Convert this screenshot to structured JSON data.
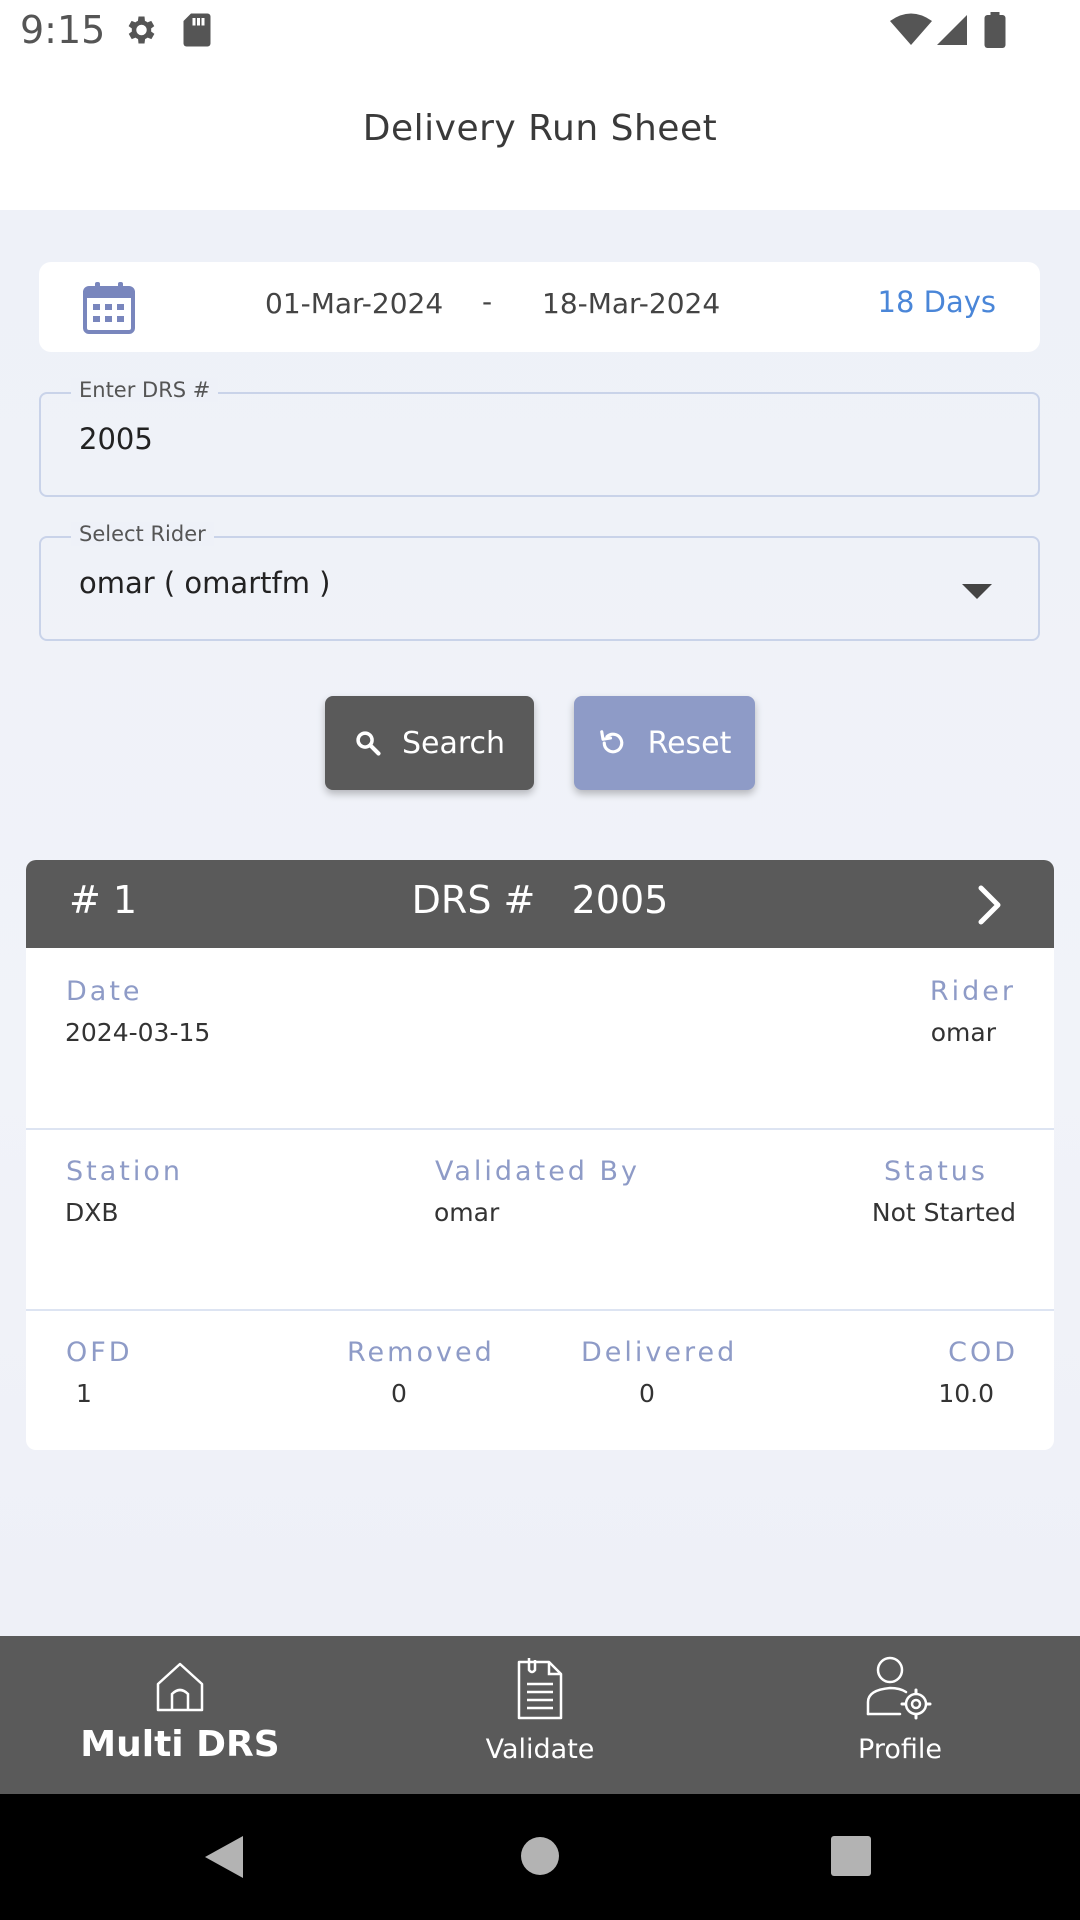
{
  "status_bar": {
    "time": "9:15"
  },
  "header": {
    "title": "Delivery Run Sheet"
  },
  "date_range": {
    "from": "01-Mar-2024",
    "separator": "-",
    "to": "18-Mar-2024",
    "days": "18 Days"
  },
  "drs_field": {
    "label": "Enter DRS #",
    "value": "2005"
  },
  "rider_field": {
    "label": "Select Rider",
    "value": "omar ( omartfm )"
  },
  "buttons": {
    "search": "Search",
    "reset": "Reset"
  },
  "drs_card": {
    "index": "# 1",
    "title": "DRS #   2005",
    "date_label": "Date",
    "date_value": "2024-03-15",
    "rider_label": "Rider",
    "rider_value": "omar",
    "station_label": "Station",
    "station_value": "DXB",
    "validated_by_label": "Validated By",
    "validated_by_value": "omar",
    "status_label": "Status",
    "status_value": "Not Started",
    "ofd_label": "OFD",
    "ofd_value": "1",
    "removed_label": "Removed",
    "removed_value": "0",
    "delivered_label": "Delivered",
    "delivered_value": "0",
    "cod_label": "COD",
    "cod_value": "10.0"
  },
  "bottom_nav": {
    "multi_drs": "Multi DRS",
    "validate": "Validate",
    "profile": "Profile"
  },
  "colors": {
    "accent": "#4a86d8",
    "header_gray": "#5a5a5a",
    "label_blue": "#8e9bc7",
    "reset_button": "#8e9bc7"
  },
  "icons": [
    "gear-icon",
    "sd-card-icon",
    "wifi-icon",
    "signal-icon",
    "battery-icon",
    "calendar-icon",
    "search-icon",
    "reset-icon",
    "chevron-right-icon",
    "home-icon",
    "document-icon",
    "user-settings-icon",
    "back-icon",
    "home-circle-icon",
    "recents-icon"
  ]
}
